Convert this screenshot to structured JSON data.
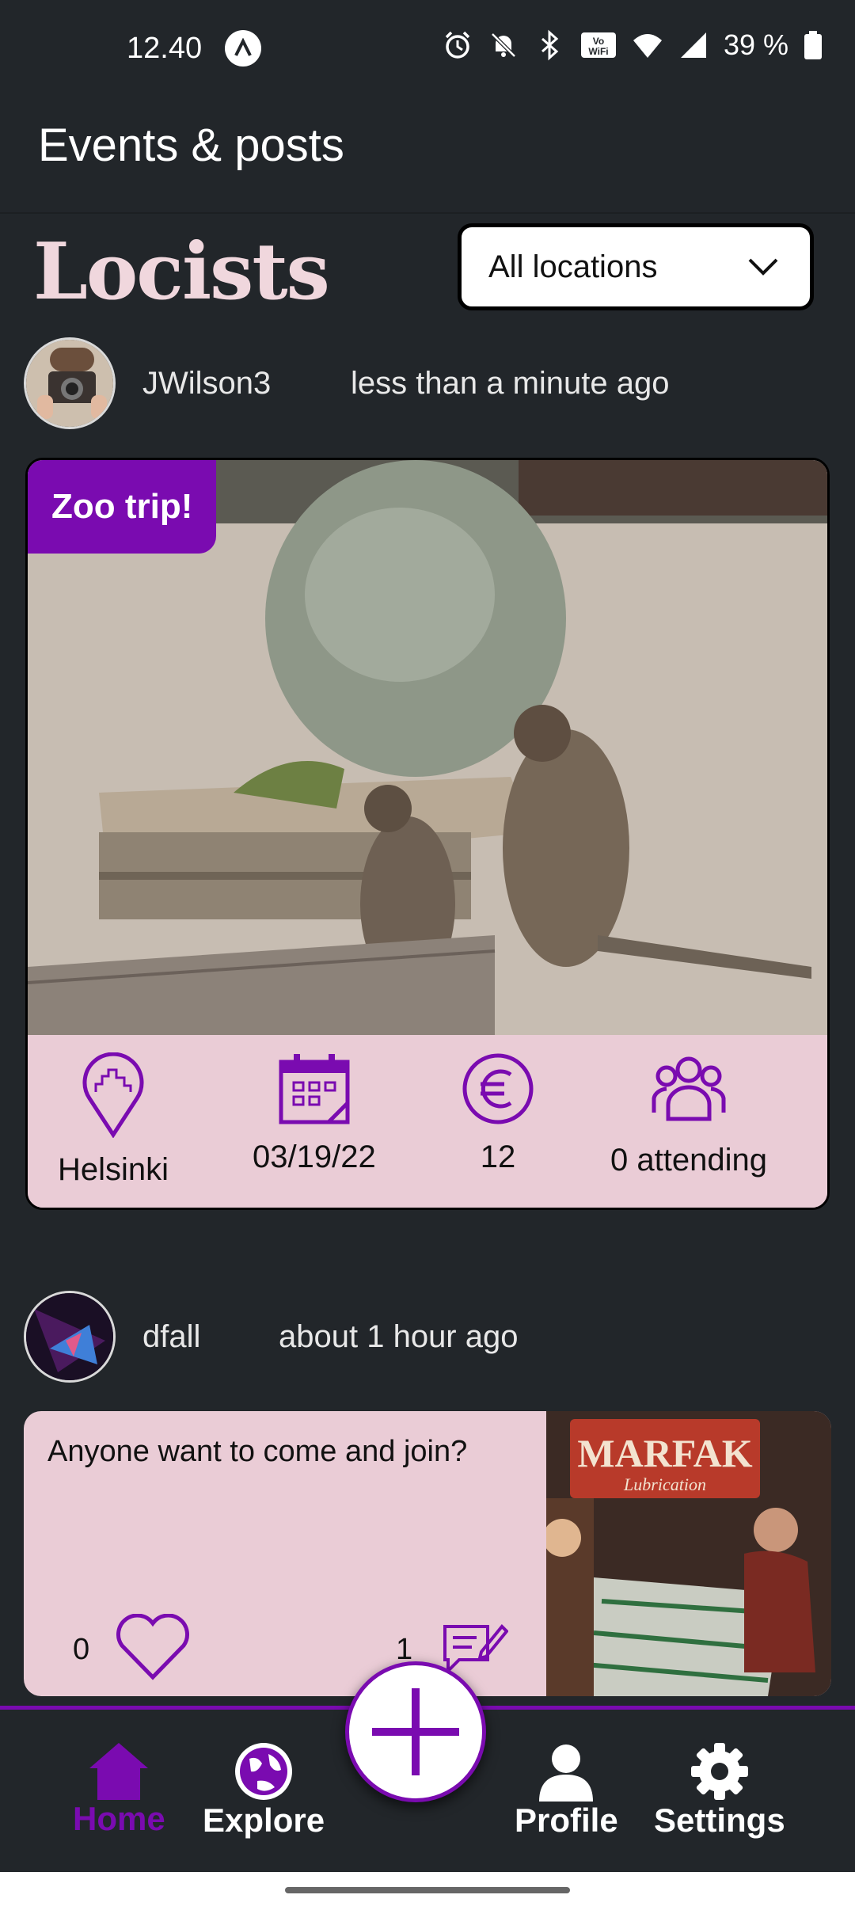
{
  "status_bar": {
    "time": "12.40",
    "battery": "39 %",
    "icons": [
      "app-a-icon",
      "alarm-icon",
      "bell-off-icon",
      "bluetooth-icon",
      "vowifi-icon",
      "wifi-icon",
      "signal-icon",
      "battery-icon"
    ]
  },
  "header": {
    "title": "Events & posts"
  },
  "logo": {
    "text": "Locists"
  },
  "location_filter": {
    "value": "All locations"
  },
  "event_post": {
    "username": "JWilson3",
    "time": "less than a minute ago",
    "badge": "Zoo trip!",
    "location": "Helsinki",
    "date": "03/19/22",
    "price": "12",
    "attending": "0 attending"
  },
  "post": {
    "username": "dfall",
    "time": "about 1 hour ago",
    "text": "Anyone want to come and join?",
    "likes": "0",
    "comments": "1"
  },
  "nav": {
    "home": "Home",
    "explore": "Explore",
    "profile": "Profile",
    "settings": "Settings"
  },
  "colors": {
    "accent": "#7a0bb0",
    "card_bg": "#eaccd6",
    "background": "#22262a"
  }
}
